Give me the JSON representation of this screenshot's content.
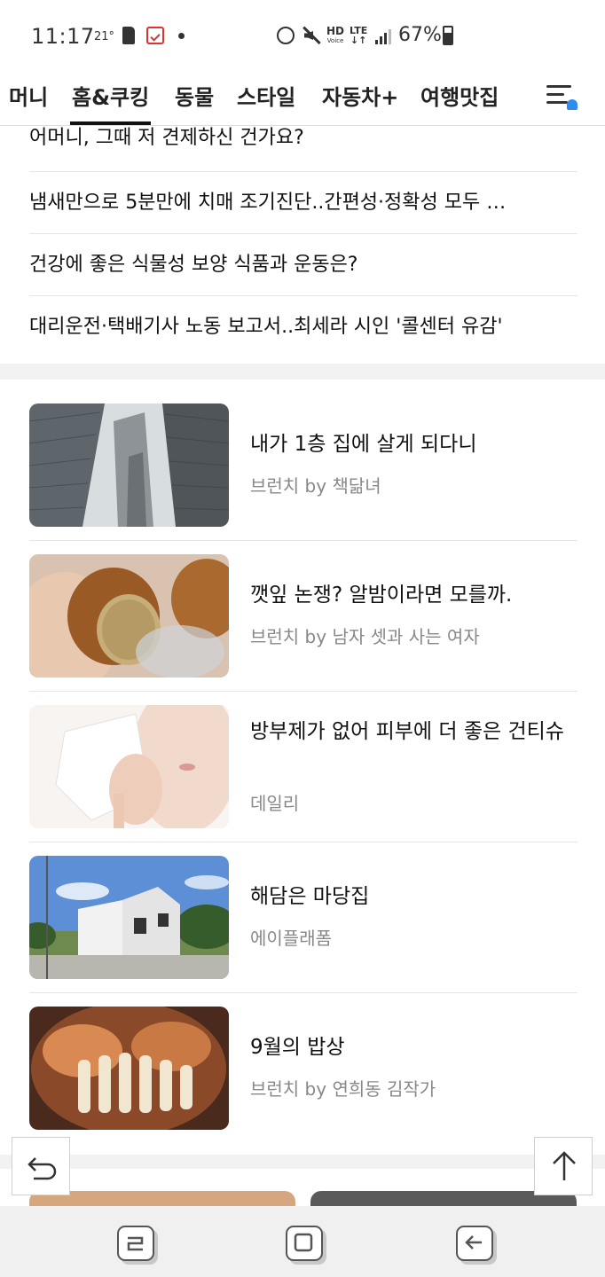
{
  "status_bar": {
    "time": "11:17",
    "temperature": "21°",
    "battery": "67%",
    "hd_label": "HD",
    "hd_sub": "Voice",
    "lte_label": "LTE"
  },
  "tabs": [
    {
      "label": "머니",
      "active": false
    },
    {
      "label": "홈&쿠킹",
      "active": true
    },
    {
      "label": "동물",
      "active": false
    },
    {
      "label": "스타일",
      "active": false
    },
    {
      "label": "자동차+",
      "active": false
    },
    {
      "label": "여행맛집",
      "active": false
    }
  ],
  "text_news": [
    "어머니, 그때 저 견제하신 건가요?",
    "냄새만으로 5분만에 치매 조기진단..간편성·정확성 모두 …",
    "건강에 좋은 식물성 보양 식품과 운동은?",
    "대리운전·택배기사 노동 보고서..최세라 시인 '콜센터 유감'"
  ],
  "articles": [
    {
      "title": "내가 1층 집에 살게 되다니",
      "source": "브런치 by 책닮녀"
    },
    {
      "title": "깻잎 논쟁? 알밤이라면 모를까.",
      "source": "브런치 by 남자 셋과 사는 여자"
    },
    {
      "title": "방부제가 없어 피부에 더 좋은 건티슈",
      "source": "데일리"
    },
    {
      "title": "해담은 마당집",
      "source": "에이플래폼"
    },
    {
      "title": "9월의 밥상",
      "source": "브런치 by 연희동 김작가"
    }
  ],
  "icons": {
    "menu": "hamburger-menu-icon",
    "undo": "undo-arrow-icon",
    "top": "scroll-to-top-icon",
    "nav_recent": "recent-apps-icon",
    "nav_home": "home-icon",
    "nav_back": "back-icon"
  },
  "colors": {
    "accent_bell": "#2d8cf0",
    "text_primary": "#111111",
    "text_secondary": "#888888"
  }
}
